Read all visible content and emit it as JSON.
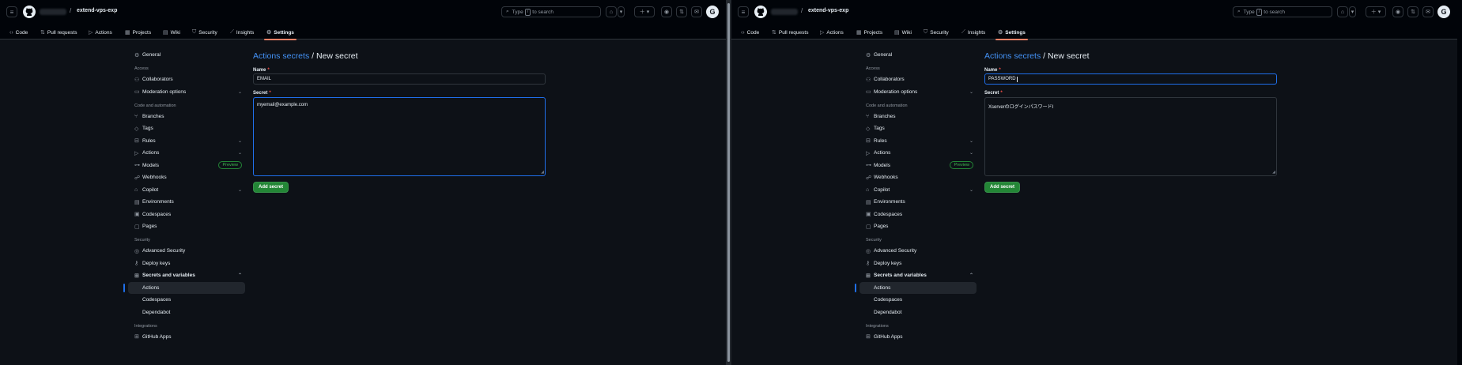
{
  "repo": {
    "name": "extend-vps-exp"
  },
  "search": {
    "text_before": "Type",
    "key": "/",
    "text_after": "to search"
  },
  "avatar_letter": "G",
  "tabs": [
    {
      "label": "Code",
      "icon": "code-icon",
      "glyph": "‹›"
    },
    {
      "label": "Pull requests",
      "icon": "pull-request-icon",
      "glyph": "⇅"
    },
    {
      "label": "Actions",
      "icon": "play-icon",
      "glyph": "▷"
    },
    {
      "label": "Projects",
      "icon": "table-icon",
      "glyph": "▦"
    },
    {
      "label": "Wiki",
      "icon": "book-icon",
      "glyph": "▤"
    },
    {
      "label": "Security",
      "icon": "shield-icon",
      "glyph": "⛉"
    },
    {
      "label": "Insights",
      "icon": "graph-icon",
      "glyph": "⟋"
    },
    {
      "label": "Settings",
      "icon": "gear-icon",
      "glyph": "⚙"
    }
  ],
  "sidebar": {
    "general": "General",
    "access_heading": "Access",
    "collaborators": "Collaborators",
    "moderation": "Moderation options",
    "code_heading": "Code and automation",
    "branches": "Branches",
    "tags": "Tags",
    "rules": "Rules",
    "actions": "Actions",
    "models": "Models",
    "models_badge": "Preview",
    "webhooks": "Webhooks",
    "copilot": "Copilot",
    "environments": "Environments",
    "codespaces": "Codespaces",
    "pages": "Pages",
    "security_heading": "Security",
    "advanced_security": "Advanced Security",
    "deploy_keys": "Deploy keys",
    "secrets": "Secrets and variables",
    "secrets_actions": "Actions",
    "secrets_codespaces": "Codespaces",
    "secrets_dependabot": "Dependabot",
    "integrations_heading": "Integrations",
    "github_apps": "GitHub Apps"
  },
  "form": {
    "breadcrumb_link": "Actions secrets",
    "breadcrumb_sep": "/",
    "breadcrumb_current": "New secret",
    "name_label": "Name",
    "secret_label": "Secret",
    "required_mark": "*",
    "submit_label": "Add secret"
  },
  "left_panel": {
    "name_value": "EMAIL",
    "secret_value": "myemail@example.com"
  },
  "right_panel": {
    "name_value": "PASSWORD",
    "secret_value": "XserverのログインパスワードI"
  },
  "colors": {
    "accent_blue": "#4493f8",
    "button_green": "#238636",
    "tab_underline": "#f78166"
  }
}
